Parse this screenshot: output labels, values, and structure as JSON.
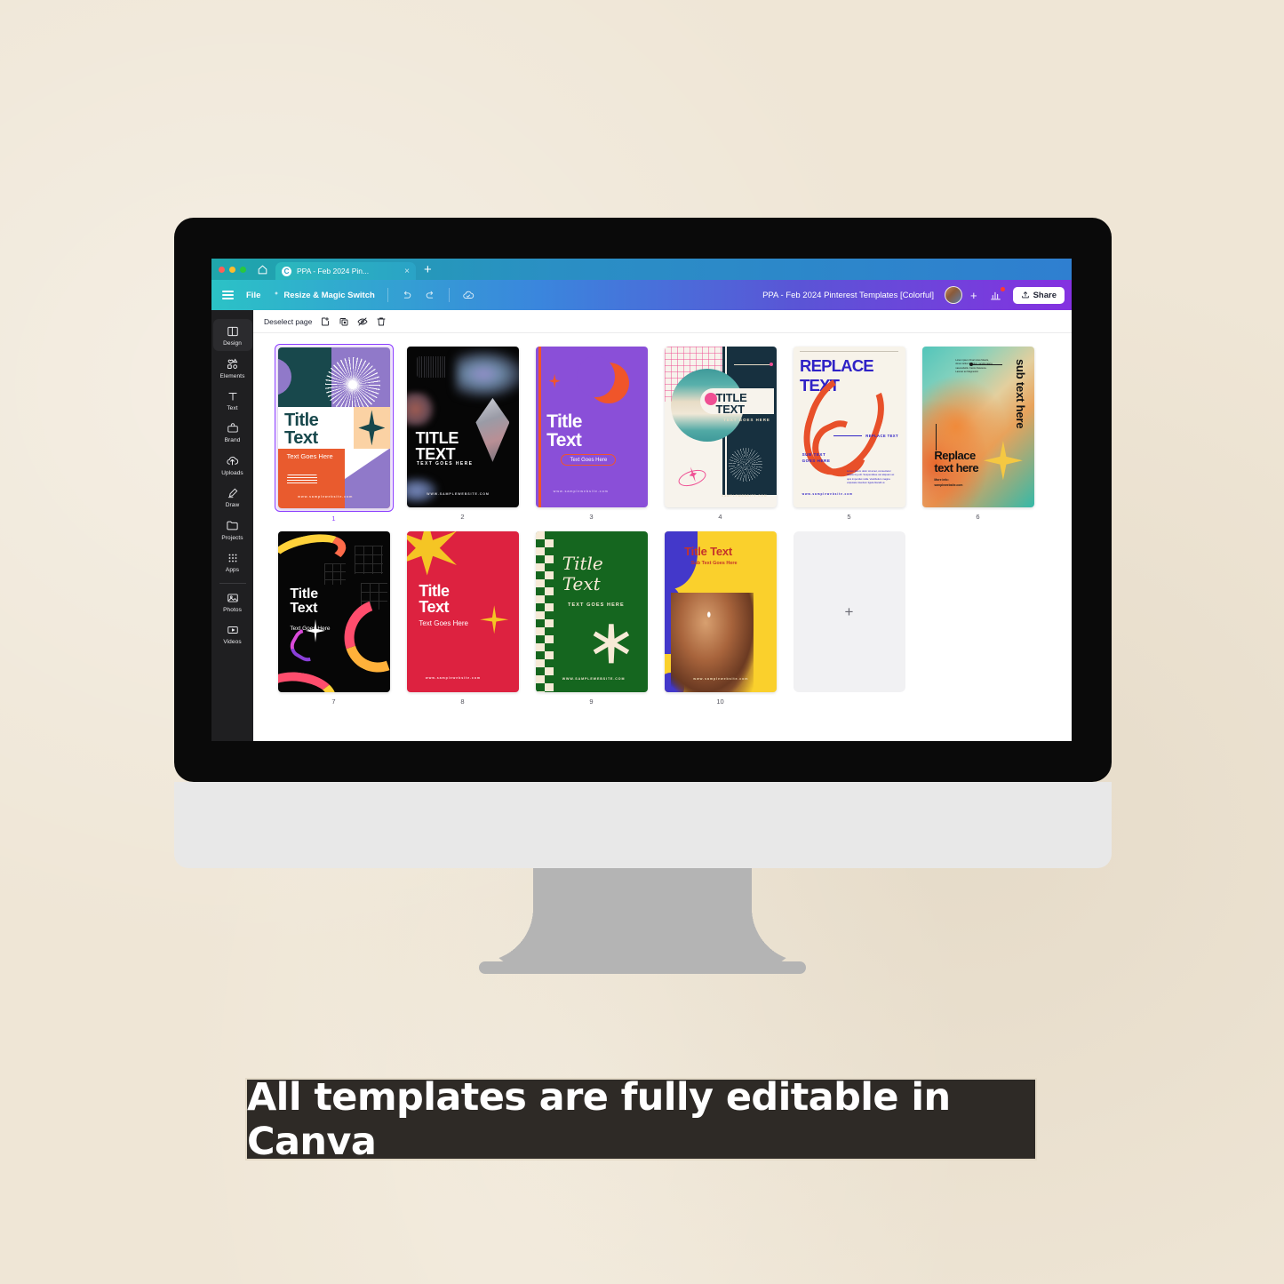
{
  "background": {
    "color": "#efe6d6"
  },
  "browser": {
    "window_controls": [
      "close",
      "minimize",
      "maximize"
    ],
    "home_icon": "home-icon",
    "tab": {
      "favicon": "C",
      "title": "PPA - Feb 2024 Pin...",
      "close": "×"
    },
    "new_tab": "+"
  },
  "toolbar": {
    "menu_icon": "hamburger-icon",
    "file_label": "File",
    "resize_label": "Resize & Magic Switch",
    "undo_icon": "undo-icon",
    "redo_icon": "redo-icon",
    "cloud_icon": "cloud-saved-icon",
    "doc_title": "PPA - Feb 2024 Pinterest Templates [Colorful]",
    "avatar": "user-avatar",
    "add_collaborator": "+",
    "insights_icon": "insights-icon",
    "share_label": "Share",
    "accent": "#8b3dff"
  },
  "sidebar": {
    "items": [
      {
        "label": "Design",
        "icon": "design-icon",
        "active": true
      },
      {
        "label": "Elements",
        "icon": "elements-icon",
        "active": false
      },
      {
        "label": "Text",
        "icon": "text-icon",
        "active": false
      },
      {
        "label": "Brand",
        "icon": "brand-icon",
        "active": false
      },
      {
        "label": "Uploads",
        "icon": "uploads-icon",
        "active": false
      },
      {
        "label": "Draw",
        "icon": "draw-icon",
        "active": false
      },
      {
        "label": "Projects",
        "icon": "projects-icon",
        "active": false
      },
      {
        "label": "Apps",
        "icon": "apps-icon",
        "active": false
      },
      {
        "label": "Photos",
        "icon": "photos-icon",
        "active": false
      },
      {
        "label": "Videos",
        "icon": "videos-icon",
        "active": false
      }
    ]
  },
  "workspace": {
    "deselect_label": "Deselect page",
    "actions": [
      "add-page-icon",
      "duplicate-page-icon",
      "hide-page-icon",
      "delete-page-icon"
    ],
    "add_page_plus": "+",
    "pages": [
      {
        "number": "1",
        "selected": true,
        "style": "t1",
        "title": "Title\nText",
        "subtitle": "Text Goes Here",
        "url": "www.samplewebsite.com"
      },
      {
        "number": "2",
        "selected": false,
        "style": "t2",
        "title": "TITLE\nTEXT",
        "subtitle": "TEXT GOES HERE",
        "url": "WWW.SAMPLEWEBSITE.COM"
      },
      {
        "number": "3",
        "selected": false,
        "style": "t3",
        "title": "Title\nText",
        "subtitle": "Text Goes Here",
        "url": "www.samplewebsite.com"
      },
      {
        "number": "4",
        "selected": false,
        "style": "t4",
        "title": "TITLE\nTEXT",
        "subtitle": "TEXT GOES HERE",
        "url": "SAMPLEWEBSITE.COM"
      },
      {
        "number": "5",
        "selected": false,
        "style": "t5",
        "title": "REPLACE\nTEXT",
        "subtitle": "SUB TEXT\nGOES HERE",
        "note": "REPLACE TEXT",
        "body": "Lorem ipsum dolor sit amet, consectetur adipiscing elit. Suspendisse var aliquam ac quis imperdiet nulla. Vestibulum magna vulputate interdum ligula blandit ut.",
        "url": "www.samplewebsite.com"
      },
      {
        "number": "6",
        "selected": false,
        "style": "t6",
        "title": "Replace\ntext here",
        "vertical_text": "sub text here",
        "micro": "Lorem ipsum Final notes Mauris, donec tellus Interdum, iaculis nascu, nascendetlis. Kairos Neietena. Laoreet an Magnestid.",
        "subtitle": "More info:\nsamplewebsite.com"
      },
      {
        "number": "7",
        "selected": false,
        "style": "t7",
        "title": "Title\nText",
        "subtitle": "Text Goes Here"
      },
      {
        "number": "8",
        "selected": false,
        "style": "t8",
        "title": "Title\nText",
        "subtitle": "Text Goes Here",
        "url": "www.samplewebsite.com"
      },
      {
        "number": "9",
        "selected": false,
        "style": "t9",
        "title": "Title\nText",
        "subtitle": "TEXT GOES HERE",
        "url": "WWW.SAMPLEWEBSITE.COM"
      },
      {
        "number": "10",
        "selected": false,
        "style": "t10",
        "title": "Title Text",
        "subtitle": "Sub Text Goes Here",
        "url": "www.samplewebsite.com"
      }
    ]
  },
  "caption": {
    "text": "All templates are fully editable in Canva",
    "background": "#2e2a26",
    "text_color": "#ffffff"
  }
}
